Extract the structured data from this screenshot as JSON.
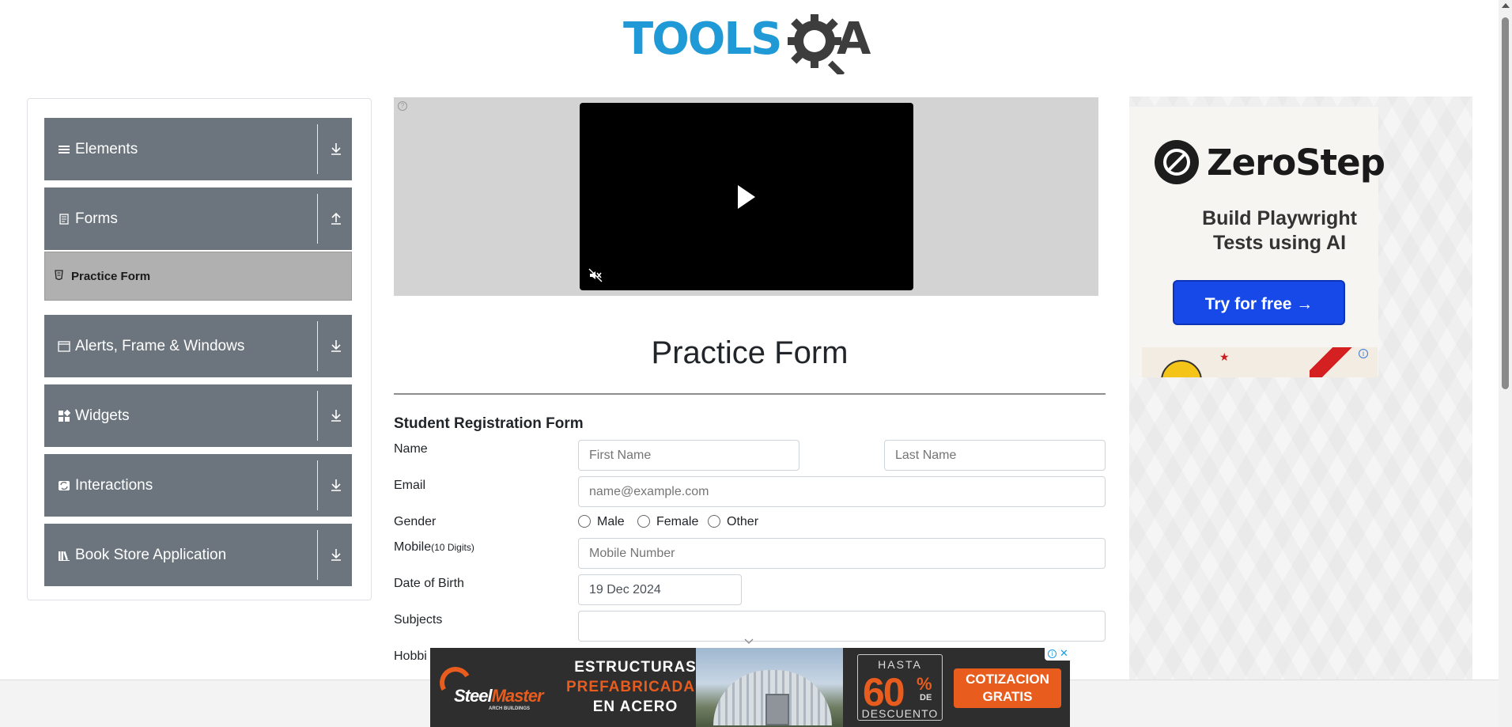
{
  "logo": {
    "part1": "TOOLS",
    "part2": "A",
    "alt": "TOOLSQA"
  },
  "sidebar": {
    "groups": [
      {
        "label": "Elements",
        "icon": "hamburger-icon",
        "expanded": false
      },
      {
        "label": "Forms",
        "icon": "document-icon",
        "expanded": true
      },
      {
        "label": "Alerts, Frame & Windows",
        "icon": "window-icon",
        "expanded": false
      },
      {
        "label": "Widgets",
        "icon": "widgets-icon",
        "expanded": false
      },
      {
        "label": "Interactions",
        "icon": "interactions-icon",
        "expanded": false
      },
      {
        "label": "Book Store Application",
        "icon": "books-icon",
        "expanded": false
      }
    ],
    "sub_items": [
      {
        "label": "Practice Form",
        "icon": "html-file-icon"
      }
    ]
  },
  "main": {
    "title": "Practice Form",
    "section_title": "Student Registration Form",
    "fields": {
      "name_label": "Name",
      "first_name_placeholder": "First Name",
      "last_name_placeholder": "Last Name",
      "email_label": "Email",
      "email_placeholder": "name@example.com",
      "gender_label": "Gender",
      "gender_options": [
        "Male",
        "Female",
        "Other"
      ],
      "mobile_label": "Mobile",
      "mobile_hint": "(10 Digits)",
      "mobile_placeholder": "Mobile Number",
      "dob_label": "Date of Birth",
      "dob_value": "19 Dec 2024",
      "subjects_label": "Subjects",
      "subjects_value": "",
      "hobbies_label": "Hobbi"
    }
  },
  "side_ad": {
    "brand": "ZeroStep",
    "tagline_line1": "Build Playwright",
    "tagline_line2": "Tests using AI",
    "cta": "Try for free →"
  },
  "bottom_ad": {
    "brand_part1": "Steel",
    "brand_part2": "Master",
    "brand_sub": "ARCH BUILDINGS",
    "head_line1": "ESTRUCTURAS",
    "head_line2": "PREFABRICADAS",
    "head_line3": "EN ACERO",
    "hasta": "HASTA",
    "percent": "60",
    "percent_sign": "%",
    "de": "DE",
    "descuento": "DESCUENTO",
    "cta_line1": "COTIZACION",
    "cta_line2": "GRATIS"
  },
  "colors": {
    "sidebar_group": "#6c757d",
    "sidebar_active": "#b0b0b0",
    "logo_blue": "#1f9ad6",
    "zerostep_button": "#1749e8",
    "steelmaster_orange": "#e85c1e"
  }
}
